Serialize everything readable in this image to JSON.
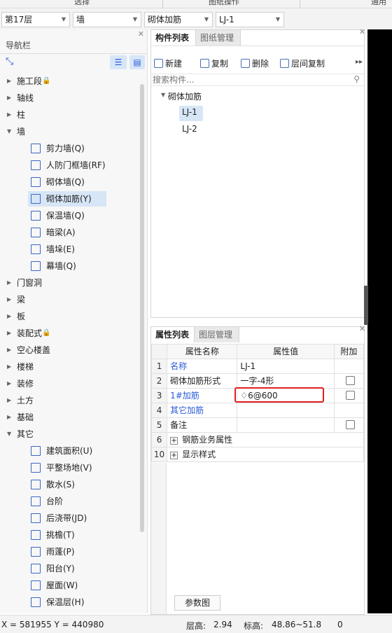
{
  "ribbon": {
    "groups": [
      "选择",
      "图纸操作",
      "通用"
    ]
  },
  "dropdowns": [
    "第17层",
    "墙",
    "砌体加筋",
    "LJ-1"
  ],
  "nav": {
    "title": "导航栏",
    "tree": [
      {
        "label": "施工段",
        "lock": true,
        "open": false
      },
      {
        "label": "轴线",
        "open": false
      },
      {
        "label": "柱",
        "open": false
      },
      {
        "label": "墙",
        "open": true,
        "children": [
          {
            "label": "剪力墙(Q)",
            "icon": "shear-wall-icon"
          },
          {
            "label": "人防门框墙(RF)",
            "icon": "civil-defense-door-icon"
          },
          {
            "label": "砌体墙(Q)",
            "icon": "masonry-wall-icon"
          },
          {
            "label": "砌体加筋(Y)",
            "icon": "masonry-rebar-icon",
            "selected": true
          },
          {
            "label": "保温墙(Q)",
            "icon": "insulation-wall-icon"
          },
          {
            "label": "暗梁(A)",
            "icon": "hidden-beam-icon"
          },
          {
            "label": "墙垛(E)",
            "icon": "wall-pier-icon"
          },
          {
            "label": "幕墙(Q)",
            "icon": "curtain-wall-icon"
          }
        ]
      },
      {
        "label": "门窗洞",
        "open": false
      },
      {
        "label": "梁",
        "open": false
      },
      {
        "label": "板",
        "open": false
      },
      {
        "label": "装配式",
        "lock": true,
        "open": false
      },
      {
        "label": "空心楼盖",
        "open": false
      },
      {
        "label": "楼梯",
        "open": false
      },
      {
        "label": "装修",
        "open": false
      },
      {
        "label": "土方",
        "open": false
      },
      {
        "label": "基础",
        "open": false
      },
      {
        "label": "其它",
        "open": true,
        "children": [
          {
            "label": "建筑面积(U)",
            "icon": "building-area-icon"
          },
          {
            "label": "平整场地(V)",
            "icon": "site-leveling-icon"
          },
          {
            "label": "散水(S)",
            "icon": "apron-icon"
          },
          {
            "label": "台阶",
            "icon": "steps-icon"
          },
          {
            "label": "后浇带(JD)",
            "icon": "post-pour-strip-icon"
          },
          {
            "label": "挑檐(T)",
            "icon": "eave-icon"
          },
          {
            "label": "雨蓬(P)",
            "icon": "canopy-icon"
          },
          {
            "label": "阳台(Y)",
            "icon": "balcony-icon"
          },
          {
            "label": "屋面(W)",
            "icon": "roof-icon"
          },
          {
            "label": "保温层(H)",
            "icon": "insulation-layer-icon"
          }
        ]
      }
    ]
  },
  "components": {
    "tabs": [
      "构件列表",
      "图纸管理"
    ],
    "toolbar": [
      "新建",
      "复制",
      "删除",
      "层间复制"
    ],
    "search_placeholder": "搜索构件...",
    "group": "砌体加筋",
    "items": [
      "LJ-1",
      "LJ-2"
    ]
  },
  "props": {
    "tabs": [
      "属性列表",
      "图层管理"
    ],
    "headers": [
      "属性名称",
      "属性值",
      "附加"
    ],
    "rows": [
      {
        "num": "1",
        "name": "名称",
        "value": "LJ-1",
        "blue": true,
        "check": false
      },
      {
        "num": "2",
        "name": "砌体加筋形式",
        "value": "一字-4形",
        "blue": false,
        "check": true
      },
      {
        "num": "3",
        "name": "1#加筋",
        "value": "♢6@600",
        "blue": true,
        "check": true,
        "highlight": true
      },
      {
        "num": "4",
        "name": "其它加筋",
        "value": "",
        "blue": true,
        "check": false
      },
      {
        "num": "5",
        "name": "备注",
        "value": "",
        "blue": false,
        "check": true
      },
      {
        "num": "6",
        "name": "钢筋业务属性",
        "value": "",
        "blue": false,
        "check": false,
        "expand": true
      },
      {
        "num": "10",
        "name": "显示样式",
        "value": "",
        "blue": false,
        "check": false,
        "expand": true
      }
    ],
    "param_button": "参数图"
  },
  "status": {
    "coords": "X = 581955 Y = 440980",
    "floor_height_label": "层高:",
    "floor_height": "2.94",
    "elev_label": "标高:",
    "elev": "48.86~51.8",
    "extra": "0"
  }
}
